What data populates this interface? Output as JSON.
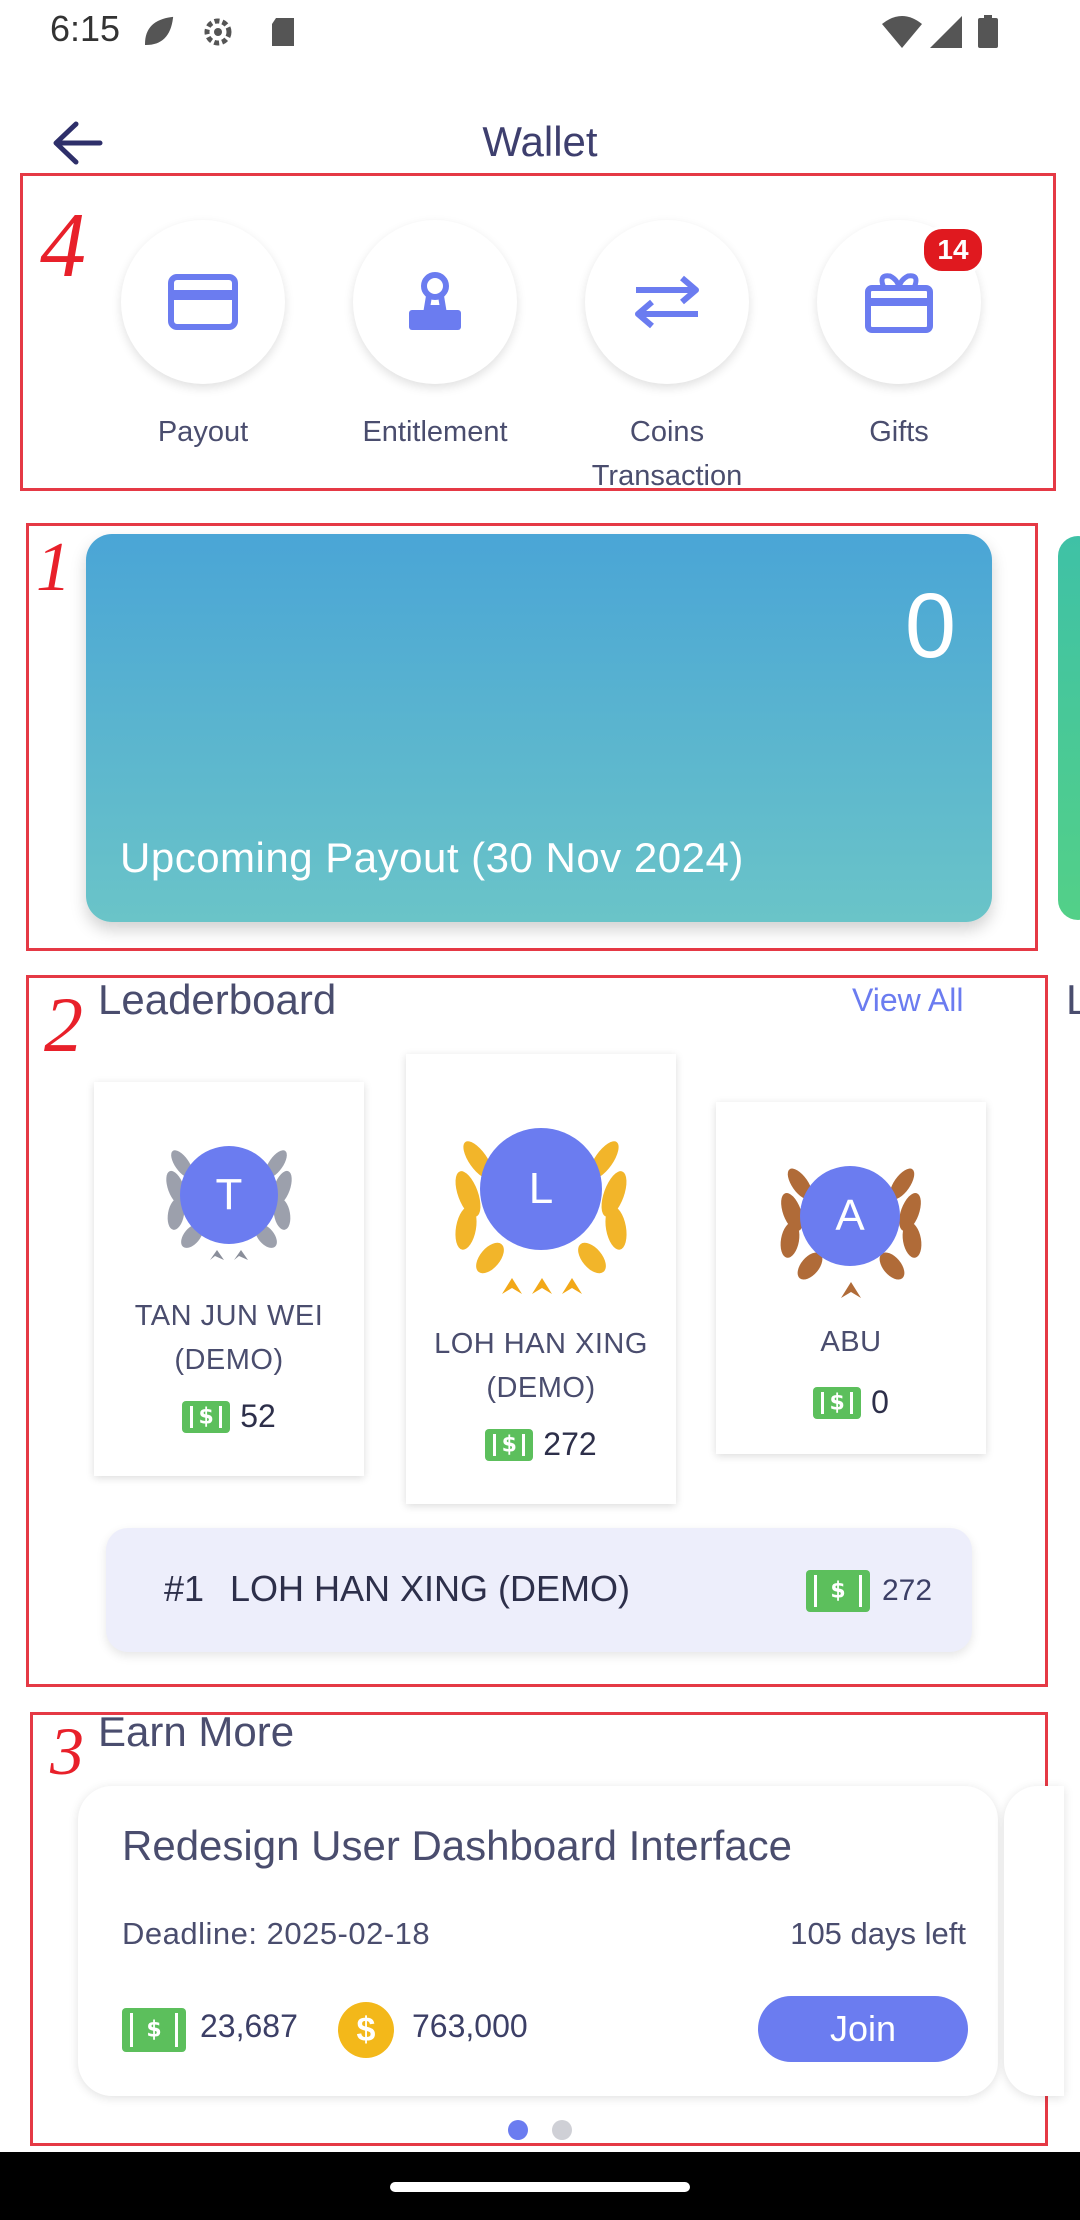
{
  "status_bar": {
    "time": "6:15"
  },
  "header": {
    "title": "Wallet"
  },
  "quick_actions": [
    {
      "label": "Payout",
      "icon": "credit-card-icon"
    },
    {
      "label": "Entitlement",
      "icon": "stamp-icon"
    },
    {
      "label": "Coins\nTransaction",
      "icon": "swap-arrows-icon"
    },
    {
      "label": "Gifts",
      "icon": "gift-icon",
      "badge": "14"
    }
  ],
  "payout_card": {
    "amount": "0",
    "label": "Upcoming Payout (30 Nov 2024)"
  },
  "leaderboard": {
    "title": "Leaderboard",
    "view_all": "View All",
    "podium": [
      {
        "rank": "2",
        "initial": "T",
        "name": "TAN JUN WEI\n(DEMO)",
        "score": "52",
        "wreath_color": "silver",
        "stars": 2
      },
      {
        "rank": "1",
        "initial": "L",
        "name": "LOH HAN XING\n(DEMO)",
        "score": "272",
        "wreath_color": "gold",
        "stars": 3
      },
      {
        "rank": "3",
        "initial": "A",
        "name": "ABU",
        "score": "0",
        "wreath_color": "bronze",
        "stars": 1
      }
    ],
    "top_user": {
      "rank": "#1",
      "name": "LOH HAN XING (DEMO)",
      "score": "272"
    }
  },
  "earn_more": {
    "title": "Earn More",
    "task": {
      "title": "Redesign User Dashboard Interface",
      "deadline": "Deadline: 2025-02-18",
      "days_left": "105 days left",
      "cash_reward": "23,687",
      "coin_reward": "763,000",
      "join_label": "Join"
    }
  },
  "annotations": [
    "1",
    "2",
    "3",
    "4"
  ],
  "colors": {
    "accent": "#6b7cf0",
    "annotation": "#e53945",
    "payout_top": "#4aa5d6",
    "payout_bottom": "#6ac4c8",
    "money_green": "#5cbf5c",
    "coin_gold": "#f3b81a",
    "badge_red": "#e0191f"
  }
}
